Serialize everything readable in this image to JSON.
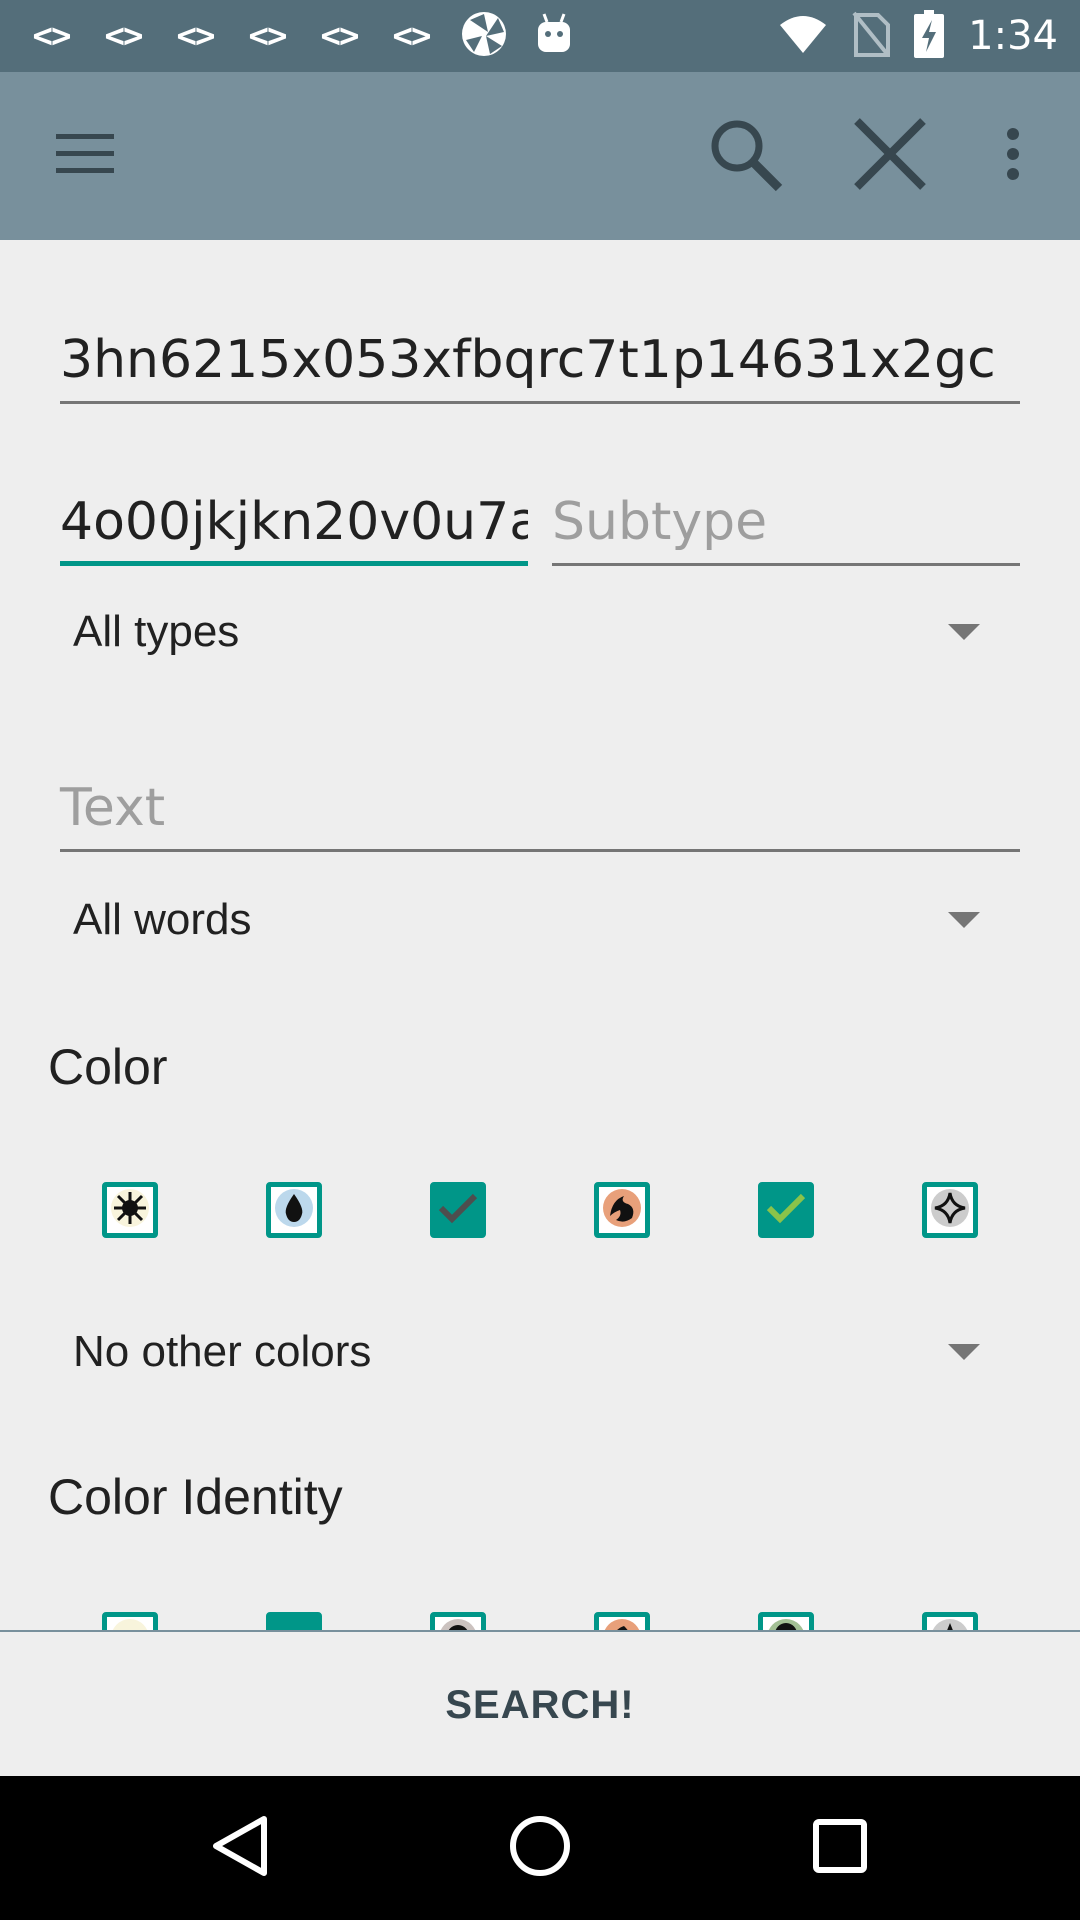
{
  "status_bar": {
    "notification_icons": [
      "<>",
      "<>",
      "<>",
      "<>",
      "<>",
      "<>"
    ],
    "time": "1:34"
  },
  "toolbar": {
    "menu_icon": "hamburger-menu-icon",
    "search_icon": "search-icon",
    "close_icon": "close-icon",
    "overflow_icon": "more-vert-icon"
  },
  "form": {
    "name_value": "3hn6215x053xfbqrc7t1p14631x2gc",
    "supertype_value": "4o00jkjkn20v0u7a",
    "subtype_placeholder": "Subtype",
    "type_select": "All types",
    "text_placeholder": "Text",
    "text_match_select": "All words",
    "color_section_title": "Color",
    "other_colors_select": "No other colors",
    "color_identity_section_title": "Color Identity"
  },
  "color_checkboxes": [
    {
      "name": "white",
      "icon": "sun-icon",
      "checked": false
    },
    {
      "name": "blue",
      "icon": "water-drop-icon",
      "checked": false
    },
    {
      "name": "black",
      "icon": "check-icon",
      "checked": true
    },
    {
      "name": "red",
      "icon": "flame-icon",
      "checked": false
    },
    {
      "name": "green",
      "icon": "check-icon",
      "checked": true
    },
    {
      "name": "colorless",
      "icon": "diamond-icon",
      "checked": false
    }
  ],
  "search_button_label": "SEARCH!",
  "colors": {
    "status_bar": "#546e7a",
    "toolbar": "#78909c",
    "accent": "#009688",
    "background": "#eeeeee"
  }
}
